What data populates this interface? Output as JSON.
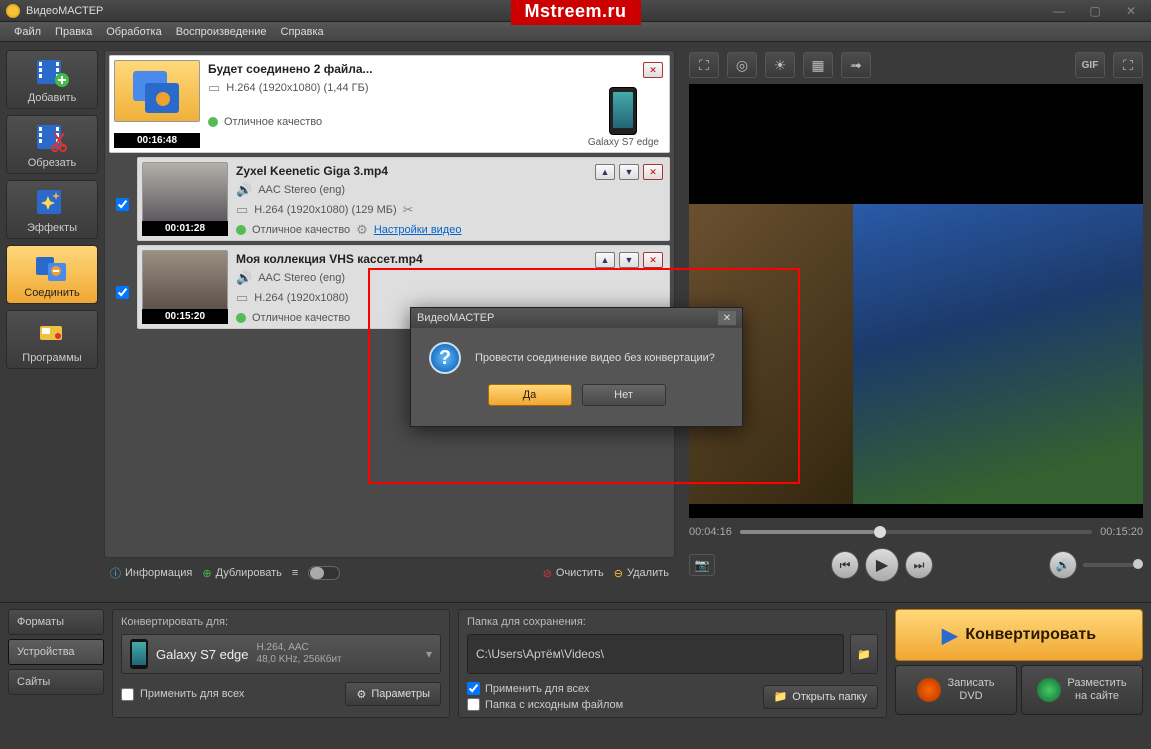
{
  "titlebar": {
    "title": "ВидеоМАСТЕР"
  },
  "watermark": "Mstreem.ru",
  "menu": {
    "file": "Файл",
    "edit": "Правка",
    "process": "Обработка",
    "playback": "Воспроизведение",
    "help": "Справка"
  },
  "sidebar": {
    "add": "Добавить",
    "cut": "Обрезать",
    "effects": "Эффекты",
    "join": "Соединить",
    "programs": "Программы"
  },
  "files": {
    "merged": {
      "title": "Будет соединено 2 файла...",
      "codec": "H.264 (1920x1080) (1,44 ГБ)",
      "quality": "Отличное качество",
      "duration": "00:16:48",
      "device": "Galaxy S7 edge"
    },
    "f1": {
      "title": "Zyxel Keenetic Giga 3.mp4",
      "audio": "AAC Stereo (eng)",
      "codec": "H.264 (1920x1080) (129 МБ)",
      "quality": "Отличное качество",
      "settings": "Настройки видео",
      "duration": "00:01:28"
    },
    "f2": {
      "title": "Моя коллекция VHS кассет.mp4",
      "audio": "AAC Stereo (eng)",
      "codec": "H.264 (1920x1080)",
      "quality": "Отличное качество",
      "duration": "00:15:20"
    }
  },
  "listbar": {
    "info": "Информация",
    "dup": "Дублировать",
    "clear": "Очистить",
    "delete": "Удалить"
  },
  "preview": {
    "pos": "00:04:16",
    "dur": "00:15:20"
  },
  "bottom": {
    "tabs": {
      "formats": "Форматы",
      "devices": "Устройства",
      "sites": "Сайты"
    },
    "convert_for": "Конвертировать для:",
    "device_name": "Galaxy S7 edge",
    "codec1": "H.264, AAC",
    "codec2": "48,0 KHz, 256Кбит",
    "apply_all": "Применить для всех",
    "params": "Параметры",
    "save_folder_hd": "Папка для сохранения:",
    "save_path": "C:\\Users\\Артём\\Videos\\",
    "source_folder": "Папка с исходным файлом",
    "open_folder": "Открыть папку",
    "convert_btn": "Конвертировать",
    "burn_dvd1": "Записать",
    "burn_dvd2": "DVD",
    "publish1": "Разместить",
    "publish2": "на сайте"
  },
  "dialog": {
    "title": "ВидеоМАСТЕР",
    "msg": "Провести соединение видео без конвертации?",
    "yes": "Да",
    "no": "Нет"
  }
}
